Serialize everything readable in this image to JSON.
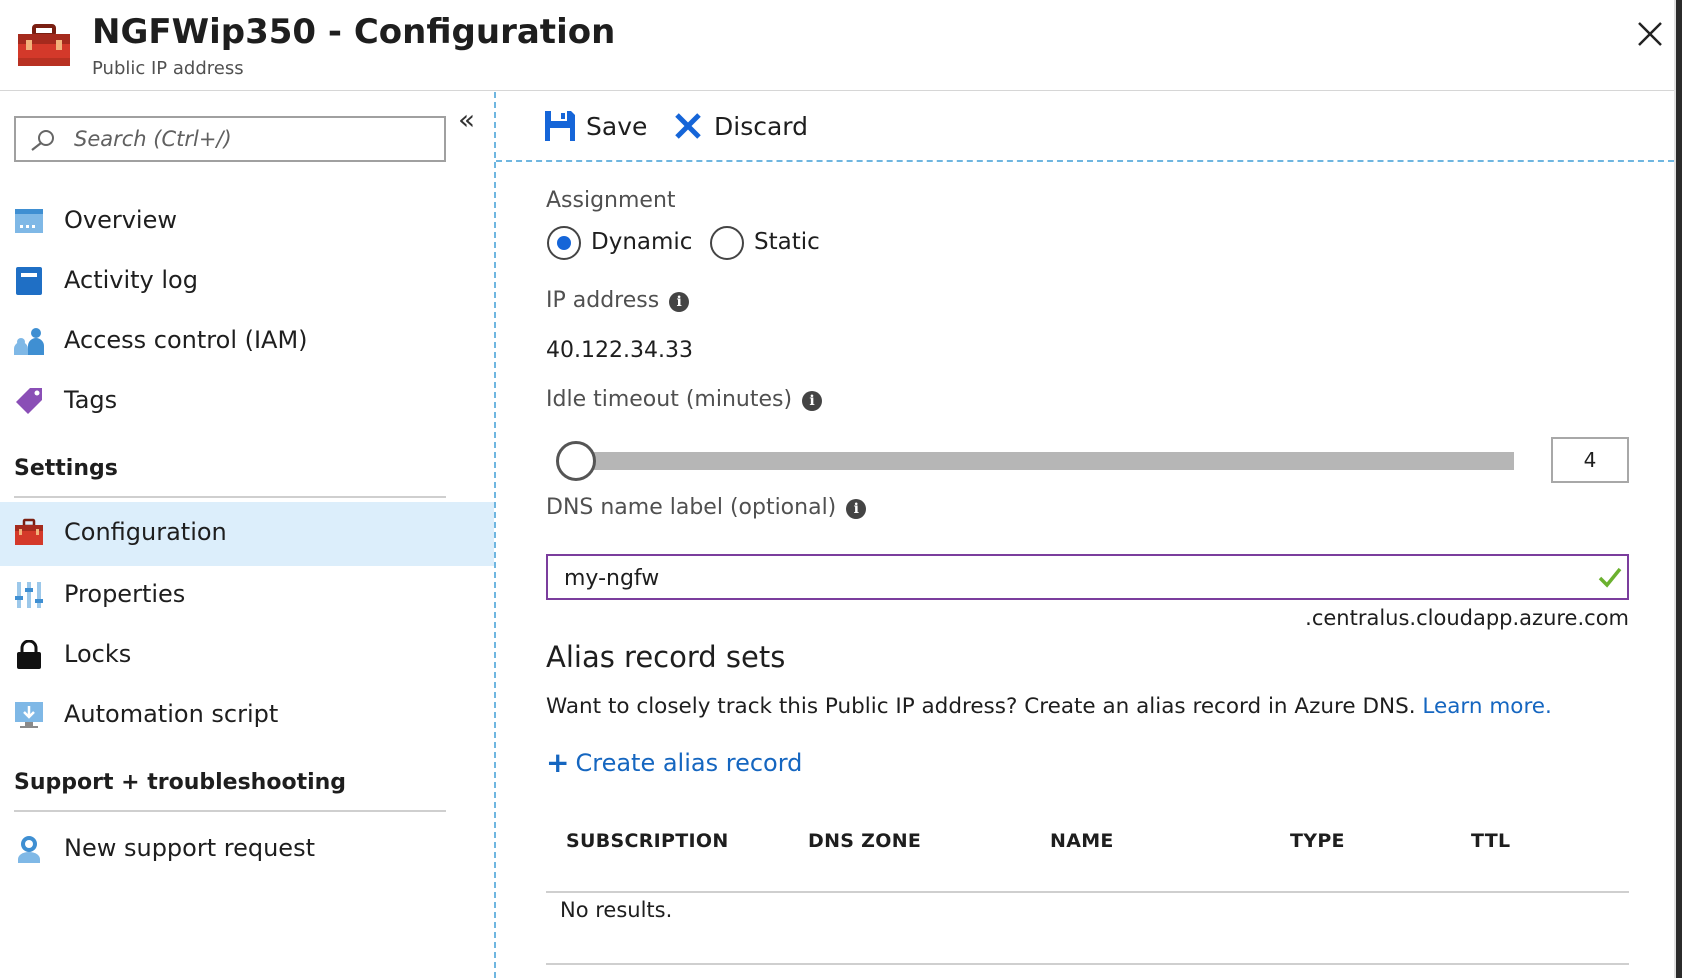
{
  "header": {
    "title": "NGFWip350 - Configuration",
    "subtitle": "Public IP address",
    "icon": "toolbox-icon",
    "close_icon": "close-icon"
  },
  "sidebar": {
    "search_placeholder": "Search (Ctrl+/)",
    "collapse_glyph": "«",
    "items": [
      {
        "label": "Overview",
        "icon": "overview-icon"
      },
      {
        "label": "Activity log",
        "icon": "activity-log-icon"
      },
      {
        "label": "Access control (IAM)",
        "icon": "iam-icon"
      },
      {
        "label": "Tags",
        "icon": "tag-icon"
      }
    ],
    "settings": {
      "heading": "Settings",
      "items": [
        {
          "label": "Configuration",
          "icon": "toolbox-icon",
          "active": true
        },
        {
          "label": "Properties",
          "icon": "properties-icon"
        },
        {
          "label": "Locks",
          "icon": "lock-icon"
        },
        {
          "label": "Automation script",
          "icon": "automation-script-icon"
        }
      ]
    },
    "support": {
      "heading": "Support + troubleshooting",
      "items": [
        {
          "label": "New support request",
          "icon": "support-request-icon"
        }
      ]
    }
  },
  "toolbar": {
    "save_label": "Save",
    "discard_label": "Discard"
  },
  "form": {
    "assignment": {
      "label": "Assignment",
      "options": [
        "Dynamic",
        "Static"
      ],
      "selected": "Dynamic"
    },
    "ip_address": {
      "label": "IP address",
      "value": "40.122.34.33"
    },
    "idle_timeout": {
      "label": "Idle timeout (minutes)",
      "value": "4",
      "fraction": 0.0
    },
    "dns": {
      "label": "DNS name label (optional)",
      "value": "my-ngfw",
      "suffix": ".centralus.cloudapp.azure.com"
    },
    "info_glyph": "i"
  },
  "alias": {
    "heading": "Alias record sets",
    "description": "Want to closely track this Public IP address? Create an alias record in Azure DNS.",
    "learn_more": "Learn more.",
    "create_label": "Create alias record",
    "create_glyph": "+",
    "columns": [
      "SUBSCRIPTION",
      "DNS ZONE",
      "NAME",
      "TYPE",
      "TTL"
    ],
    "empty_text": "No results."
  },
  "colors": {
    "accent": "#1565d8",
    "link": "#1566c0",
    "active_nav": "#dceefb",
    "focus_border": "#7b3d9d",
    "valid_check": "#6bb12f"
  }
}
